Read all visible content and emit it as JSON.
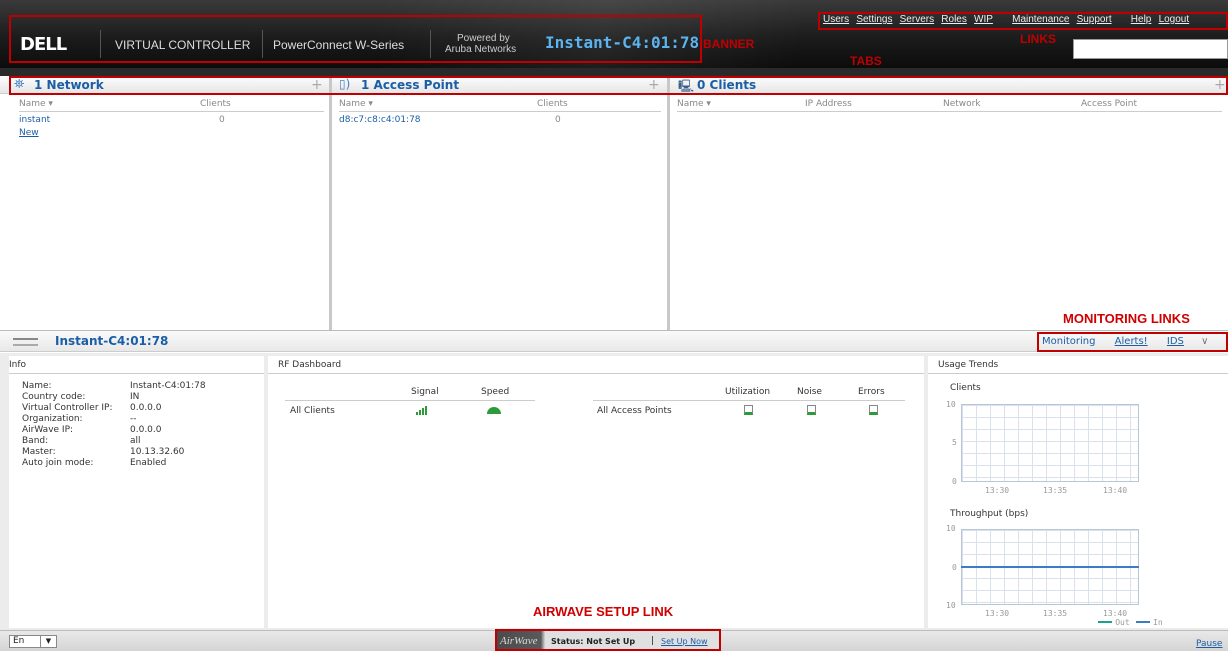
{
  "header": {
    "brand": "DELL",
    "product": "VIRTUAL CONTROLLER",
    "series": "PowerConnect W-Series",
    "powered_line1": "Powered by",
    "powered_line2": "Aruba Networks",
    "controller_name": "Instant-C4:01:78",
    "links": [
      "Users",
      "Settings",
      "Servers",
      "Roles",
      "WIP",
      "Maintenance",
      "Support",
      "Help",
      "Logout"
    ],
    "search_value": ""
  },
  "annotations": {
    "banner": "BANNER",
    "links": "LINKS",
    "tabs": "TABS",
    "monitoring_links": "MONITORING LINKS",
    "airwave_setup_link": "AIRWAVE SETUP LINK"
  },
  "networks_panel": {
    "title": "1 Network",
    "columns": [
      "Name",
      "Clients"
    ],
    "rows": [
      {
        "name": "instant",
        "clients": "0"
      }
    ],
    "new_link": "New"
  },
  "access_points_panel": {
    "title": "1 Access Point",
    "columns": [
      "Name",
      "Clients"
    ],
    "rows": [
      {
        "name": "d8:c7:c8:c4:01:78",
        "clients": "0"
      }
    ]
  },
  "clients_panel": {
    "title": "0 Clients",
    "columns": [
      "Name",
      "IP Address",
      "Network",
      "Access Point"
    ]
  },
  "detail": {
    "title": "Instant-C4:01:78",
    "monitoring_links": [
      "Monitoring",
      "Alerts!",
      "IDS"
    ]
  },
  "info": {
    "title": "Info",
    "fields": [
      {
        "label": "Name:",
        "value": "Instant-C4:01:78"
      },
      {
        "label": "Country code:",
        "value": "IN"
      },
      {
        "label": "Virtual Controller IP:",
        "value": "0.0.0.0"
      },
      {
        "label": "Organization:",
        "value": "--"
      },
      {
        "label": "AirWave IP:",
        "value": "0.0.0.0"
      },
      {
        "label": "Band:",
        "value": "all"
      },
      {
        "label": "Master:",
        "value": "10.13.32.60"
      },
      {
        "label": "Auto join mode:",
        "value": "Enabled"
      }
    ]
  },
  "rf_dashboard": {
    "title": "RF Dashboard",
    "client_columns": [
      "Signal",
      "Speed"
    ],
    "client_row": "All Clients",
    "ap_columns": [
      "Utilization",
      "Noise",
      "Errors"
    ],
    "ap_row": "All Access Points"
  },
  "usage_trends": {
    "title": "Usage Trends",
    "clients_chart": {
      "title": "Clients",
      "y_ticks": [
        "10",
        "5",
        "0"
      ],
      "x_ticks": [
        "13:30",
        "13:35",
        "13:40"
      ]
    },
    "throughput_chart": {
      "title": "Throughput  (bps)",
      "y_ticks": [
        "10",
        "0",
        "10"
      ],
      "x_ticks": [
        "13:30",
        "13:35",
        "13:40"
      ],
      "legend": [
        "Out",
        "In"
      ],
      "series_colors": {
        "Out": "#1aa38a",
        "In": "#3a7cc8"
      }
    }
  },
  "statusbar": {
    "language": "En",
    "airwave_brand": "AirWave",
    "status_text": "Status: Not Set Up",
    "separator": "|",
    "setup_link": "Set Up Now",
    "pause": "Pause"
  }
}
